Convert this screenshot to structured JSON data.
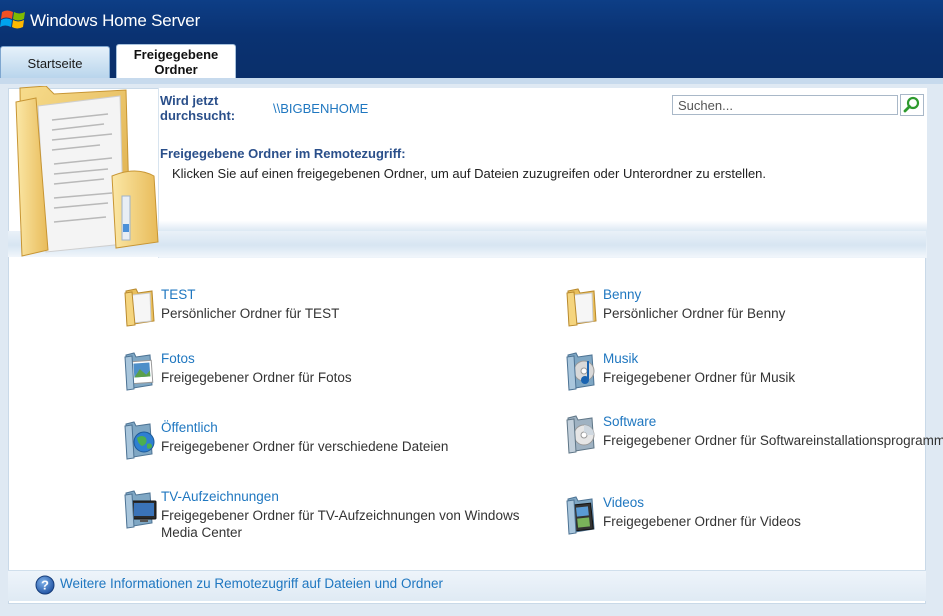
{
  "app": {
    "title": "Windows Home Server"
  },
  "tabs": [
    {
      "label": "Startseite"
    },
    {
      "label": "Freigegebene Ordner"
    }
  ],
  "scan": {
    "label": "Wird jetzt durchsucht:",
    "value": "\\\\BIGBENHOME"
  },
  "search": {
    "placeholder": "Suchen..."
  },
  "intro": {
    "title": "Freigegebene Ordner im Remotezugriff:",
    "text": "Klicken Sie auf einen freigegebenen Ordner, um auf Dateien zuzugreifen oder Unterordner zu erstellen."
  },
  "folders": [
    {
      "name": "TEST",
      "desc": "Persönlicher Ordner für TEST",
      "icon": "personal-folder-icon"
    },
    {
      "name": "Benny",
      "desc": "Persönlicher Ordner für Benny",
      "icon": "personal-folder-icon"
    },
    {
      "name": "Fotos",
      "desc": "Freigegebener Ordner für Fotos",
      "icon": "photos-folder-icon"
    },
    {
      "name": "Musik",
      "desc": "Freigegebener Ordner für Musik",
      "icon": "music-folder-icon"
    },
    {
      "name": "Öffentlich",
      "desc": "Freigegebener Ordner für verschiedene Dateien",
      "icon": "public-folder-icon"
    },
    {
      "name": "Software",
      "desc": "Freigegebener Ordner für Softwareinstallationsprogramme",
      "icon": "software-folder-icon"
    },
    {
      "name": "TV-Aufzeichnungen",
      "desc": "Freigegebener Ordner für TV-Aufzeichnungen von Windows Media Center",
      "icon": "tv-folder-icon"
    },
    {
      "name": "Videos",
      "desc": "Freigegebener Ordner für Videos",
      "icon": "videos-folder-icon"
    }
  ],
  "footer": {
    "help_link": "Weitere Informationen zu Remotezugriff auf Dateien und Ordner"
  },
  "colors": {
    "header": "#0a3272",
    "link": "#1f77c0",
    "heading": "#2a4f8a"
  }
}
